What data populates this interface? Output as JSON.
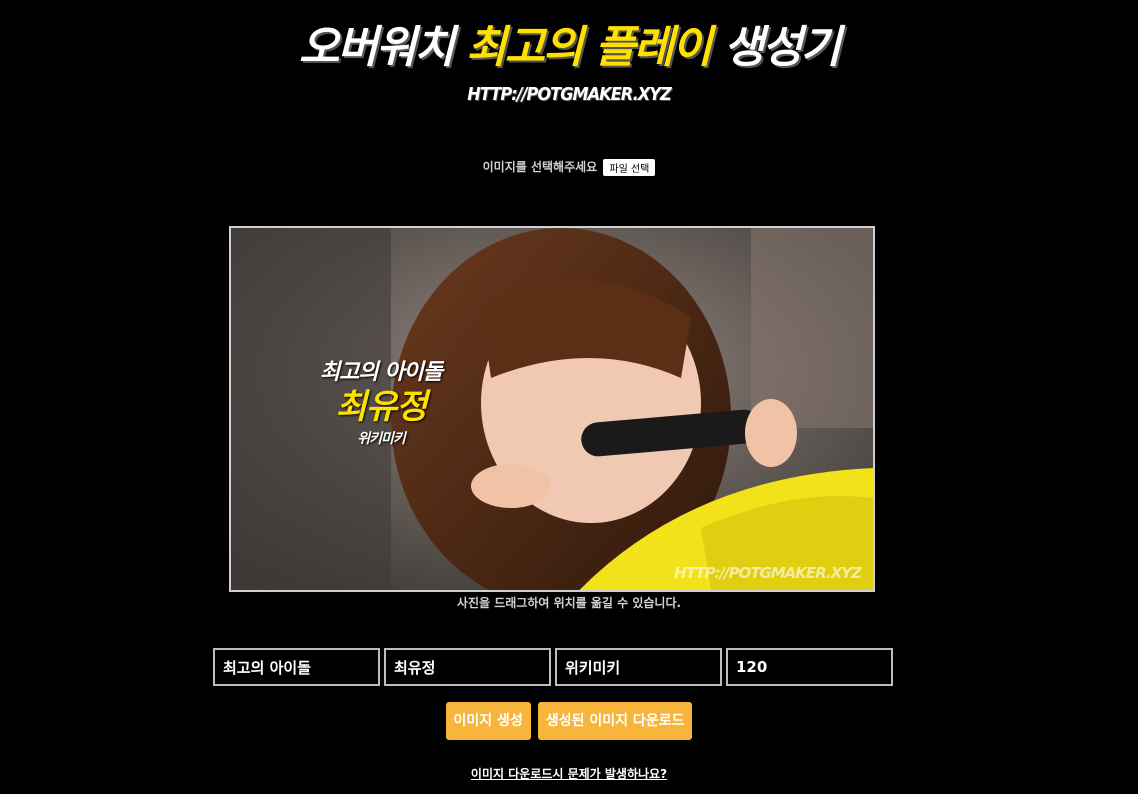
{
  "header": {
    "title_part1": "오버워치 ",
    "title_highlight": "최고의 플레이",
    "title_part2": " 생성기",
    "url": "HTTP://POTGMAKER.XYZ"
  },
  "file_picker": {
    "label": "이미지를 선택해주세요",
    "button": "파일 선택"
  },
  "preview": {
    "line1": "최고의 아이돌",
    "line2": "최유정",
    "line3": "위키미키",
    "watermark": "HTTP://POTGMAKER.XYZ"
  },
  "hint": "사진을 드래그하여 위치를 옮길 수 있습니다.",
  "fields": {
    "title": "최고의 아이돌",
    "name": "최유정",
    "subtitle": "위키미키",
    "size": "120"
  },
  "buttons": {
    "generate": "이미지 생성",
    "download": "생성된 이미지 다운로드"
  },
  "help_link": "이미지 다운로드시 문제가 발생하나요?",
  "colors": {
    "accent_yellow": "#ffe100",
    "button_orange": "#f7b53c",
    "background": "#000000"
  }
}
